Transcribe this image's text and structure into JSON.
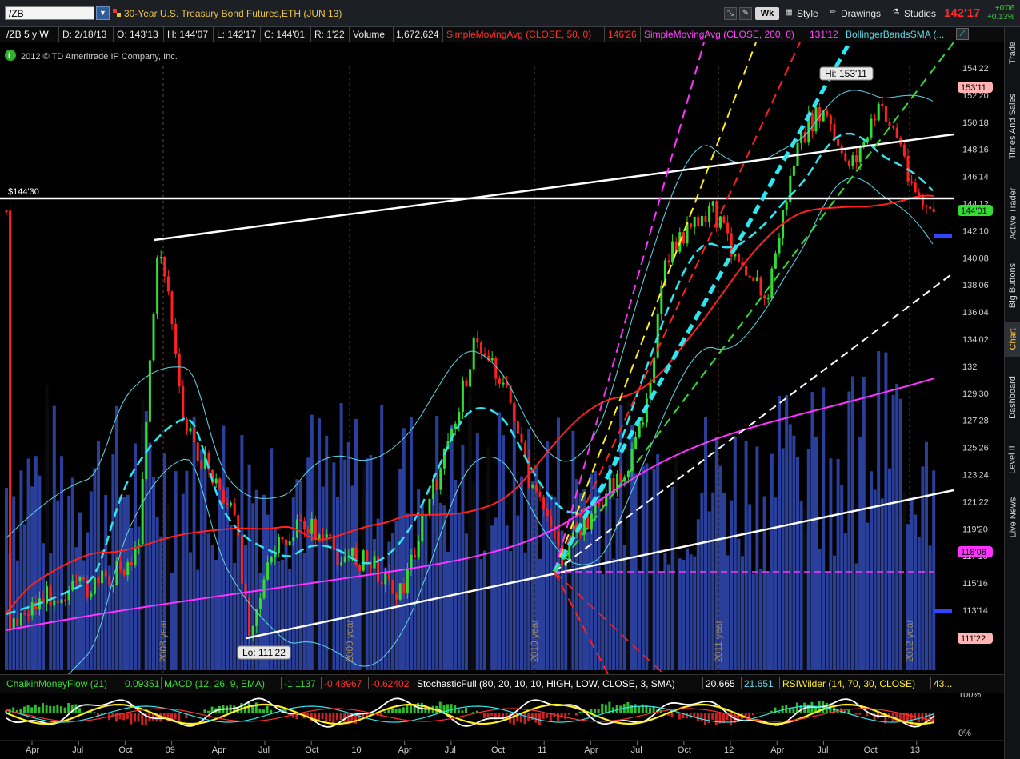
{
  "toolbar": {
    "symbol": "/ZB",
    "instrument_title": "30-Year U.S. Treasury Bond Futures,ETH (JUN 13)",
    "wk_label": "Wk",
    "style_label": "Style",
    "drawings_label": "Drawings",
    "studies_label": "Studies",
    "last_price": "142'17",
    "net_change": "+0'06",
    "pct_change": "+0.13%"
  },
  "info_bar": {
    "symbol_period": "/ZB 5 y W",
    "date": "D: 2/18/13",
    "open": "O: 143'13",
    "high": "H: 144'07",
    "low": "L: 142'17",
    "close": "C: 144'01",
    "range": "R: 1'22",
    "volume_label": "Volume",
    "volume_value": "1,672,624",
    "sma50_label": "SimpleMovingAvg (CLOSE, 50, 0)",
    "sma50_value": "146'26",
    "sma200_label": "SimpleMovingAvg (CLOSE, 200, 0)",
    "sma200_value": "131'12",
    "bollinger_label": "BollingerBandsSMA (..."
  },
  "copyright": "2012 © TD Ameritrade IP Company, Inc.",
  "price_line_label": "$144'30",
  "high_label": "Hi: 153'11",
  "low_label": "Lo: 111'22",
  "price_axis": [
    "154'22",
    "152'20",
    "150'18",
    "148'16",
    "146'14",
    "144'12",
    "142'10",
    "140'08",
    "138'06",
    "136'04",
    "134'02",
    "132",
    "129'30",
    "127'28",
    "125'26",
    "123'24",
    "121'22",
    "119'20",
    "117'18",
    "115'16",
    "113'14",
    "111'12"
  ],
  "price_markers": [
    {
      "label": "153'11",
      "color": "#ffb3b3",
      "text": "#000"
    },
    {
      "label": "144'01",
      "color": "#33dd33",
      "text": "#000"
    },
    {
      "label": "118'08",
      "color": "#ff33ff",
      "text": "#000"
    },
    {
      "label": "111'22",
      "color": "#ffb3b3",
      "text": "#000"
    }
  ],
  "year_labels": [
    "2008 year",
    "2009 year",
    "2010 year",
    "2011 year",
    "2012 year"
  ],
  "side_tabs": [
    "Trade",
    "Times And Sales",
    "Active Trader",
    "Big Buttons",
    "Chart",
    "Dashboard",
    "Level II",
    "Live News"
  ],
  "indicators": {
    "cmf_label": "ChaikinMoneyFlow (21)",
    "cmf_value": "0.09351",
    "macd_label": "MACD (12, 26, 9, EMA)",
    "macd_value": "-1.1137",
    "macd_avg": "-0.48967",
    "macd_diff": "-0.62402",
    "stoch_label": "StochasticFull (80, 20, 10, 10, HIGH, LOW, CLOSE, 3, SMA)",
    "stoch_k": "20.665",
    "stoch_d": "21.651",
    "rsi_label": "RSIWilder (14, 70, 30, CLOSE)",
    "rsi_value": "43..."
  },
  "osc_axis": [
    "100%",
    "0%"
  ],
  "time_axis": [
    "Apr",
    "Jul",
    "Oct",
    "09",
    "Apr",
    "Jul",
    "Oct",
    "10",
    "Apr",
    "Jul",
    "Oct",
    "11",
    "Apr",
    "Jul",
    "Oct",
    "12",
    "Apr",
    "Jul",
    "Oct",
    "13"
  ],
  "colors": {
    "up_candle": "#33dd33",
    "down_candle": "#ff2020",
    "volume": "#2a3f9a",
    "sma50": "#ff2020",
    "sma200": "#ff33ff",
    "bollinger": "#5fd8e8",
    "bollinger_mid": "#2ee6f0",
    "trendline": "#ffffff"
  }
}
